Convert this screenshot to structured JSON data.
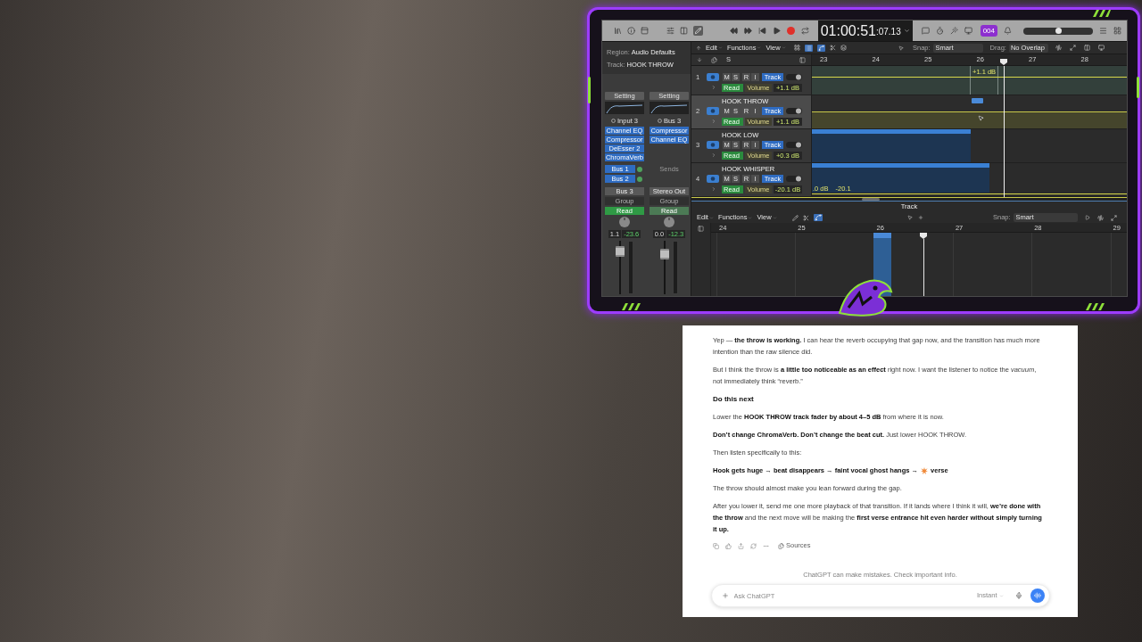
{
  "daw": {
    "control_bar": {
      "timecode": "01:00:51",
      "timecode_frames": ":07.13",
      "badge": "004",
      "master_volume": {
        "level": 0.5
      }
    },
    "inspector": {
      "region_label": "Region:",
      "region_value": "Audio Defaults",
      "track_label": "Track:",
      "track_value": "HOOK THROW",
      "strips": [
        {
          "setting": "Setting",
          "input": "Input 3",
          "plugins": [
            "Channel EQ",
            "Compressor",
            "DeEsser 2",
            "ChromaVerb"
          ],
          "sends": [
            "Bus 1",
            "Bus 2"
          ],
          "output": "Bus 3",
          "group": "Group",
          "automation": "Read",
          "volume": "1.1",
          "peak": "-23.6",
          "fader": {
            "level": 0.8
          }
        },
        {
          "setting": "Setting",
          "input": "Bus 3",
          "plugins": [
            "Compressor",
            "Channel EQ"
          ],
          "sends_label": "Sends",
          "output": "Stereo Out",
          "group": "Group",
          "automation": "Read",
          "volume": "0.0",
          "peak": "-12.3",
          "fader": {
            "level": 0.75
          }
        }
      ]
    },
    "tracks_toolbar": {
      "menus": [
        "Edit",
        "Functions",
        "View"
      ],
      "snap_label": "Snap:",
      "snap_value": "Smart",
      "drag_label": "Drag:",
      "drag_value": "No Overlap"
    },
    "header_letter": "S",
    "ruler": [
      "23",
      "24",
      "25",
      "26",
      "27",
      "28"
    ],
    "tracks": [
      {
        "number": "1",
        "buttons": [
          "M",
          "S",
          "R",
          "I"
        ],
        "mode": "Track",
        "automation": "Read",
        "parameter": "Volume",
        "value": "+1.1 dB",
        "lane_labels": [
          "+1.1 dB"
        ],
        "selected": false
      },
      {
        "number": "2",
        "name": "HOOK THROW",
        "buttons": [
          "M",
          "S",
          "R",
          "I"
        ],
        "mode": "Track",
        "automation": "Read",
        "parameter": "Volume",
        "value": "+1.1 dB",
        "selected": true
      },
      {
        "number": "3",
        "name": "HOOK LOW",
        "buttons": [
          "M",
          "S",
          "R",
          "I"
        ],
        "mode": "Track",
        "automation": "Read",
        "parameter": "Volume",
        "value": "+0.3 dB",
        "selected": false
      },
      {
        "number": "4",
        "name": "HOOK WHISPER",
        "buttons": [
          "M",
          "S",
          "R",
          "I"
        ],
        "mode": "Track",
        "automation": "Read",
        "parameter": "Volume",
        "value": "-20.1 dB",
        "lane_labels": [
          ".0 dB",
          "-20.1"
        ],
        "selected": false
      }
    ],
    "editor": {
      "title": "Track",
      "menus": [
        "Edit",
        "Functions",
        "View"
      ],
      "snap_label": "Snap:",
      "snap_value": "Smart",
      "ruler": [
        "24",
        "25",
        "26",
        "27",
        "28",
        "29"
      ]
    }
  },
  "chat": {
    "blocks": [
      {
        "kind": "paragraph",
        "text": "Yep — **the throw is working.** I can hear the reverb occupying that gap now, and the transition has much more intention than the raw silence did."
      },
      {
        "kind": "paragraph",
        "text": "But I think the throw is **a little too noticeable as an effect** right now. I want the listener to notice the *vacuum*, not immediately think “reverb.”"
      },
      {
        "kind": "heading",
        "text": "Do this next"
      },
      {
        "kind": "paragraph",
        "text": "Lower the **HOOK THROW track fader by about 4–5 dB** from where it is now."
      },
      {
        "kind": "paragraph",
        "text": "**Don’t change ChromaVerb. Don’t change the beat cut.** Just lower HOOK THROW."
      },
      {
        "kind": "paragraph",
        "text": "Then listen specifically to this:"
      },
      {
        "kind": "flow",
        "before": "Hook gets huge → beat disappears → faint vocal ghost hangs →",
        "after": "verse"
      },
      {
        "kind": "paragraph",
        "text": "The throw should almost make you lean forward during the gap."
      },
      {
        "kind": "paragraph",
        "text": "After you lower it, send me one more playback of that transition. If it lands where I think it will, **we’re done with the throw** and the next move will be making the **first verse entrance hit even harder without simply turning it up.**"
      }
    ],
    "sources": "Sources",
    "disclaimer": "ChatGPT can make mistakes. Check important info.",
    "composer": {
      "placeholder": "Ask ChatGPT",
      "model": "Instant"
    }
  }
}
